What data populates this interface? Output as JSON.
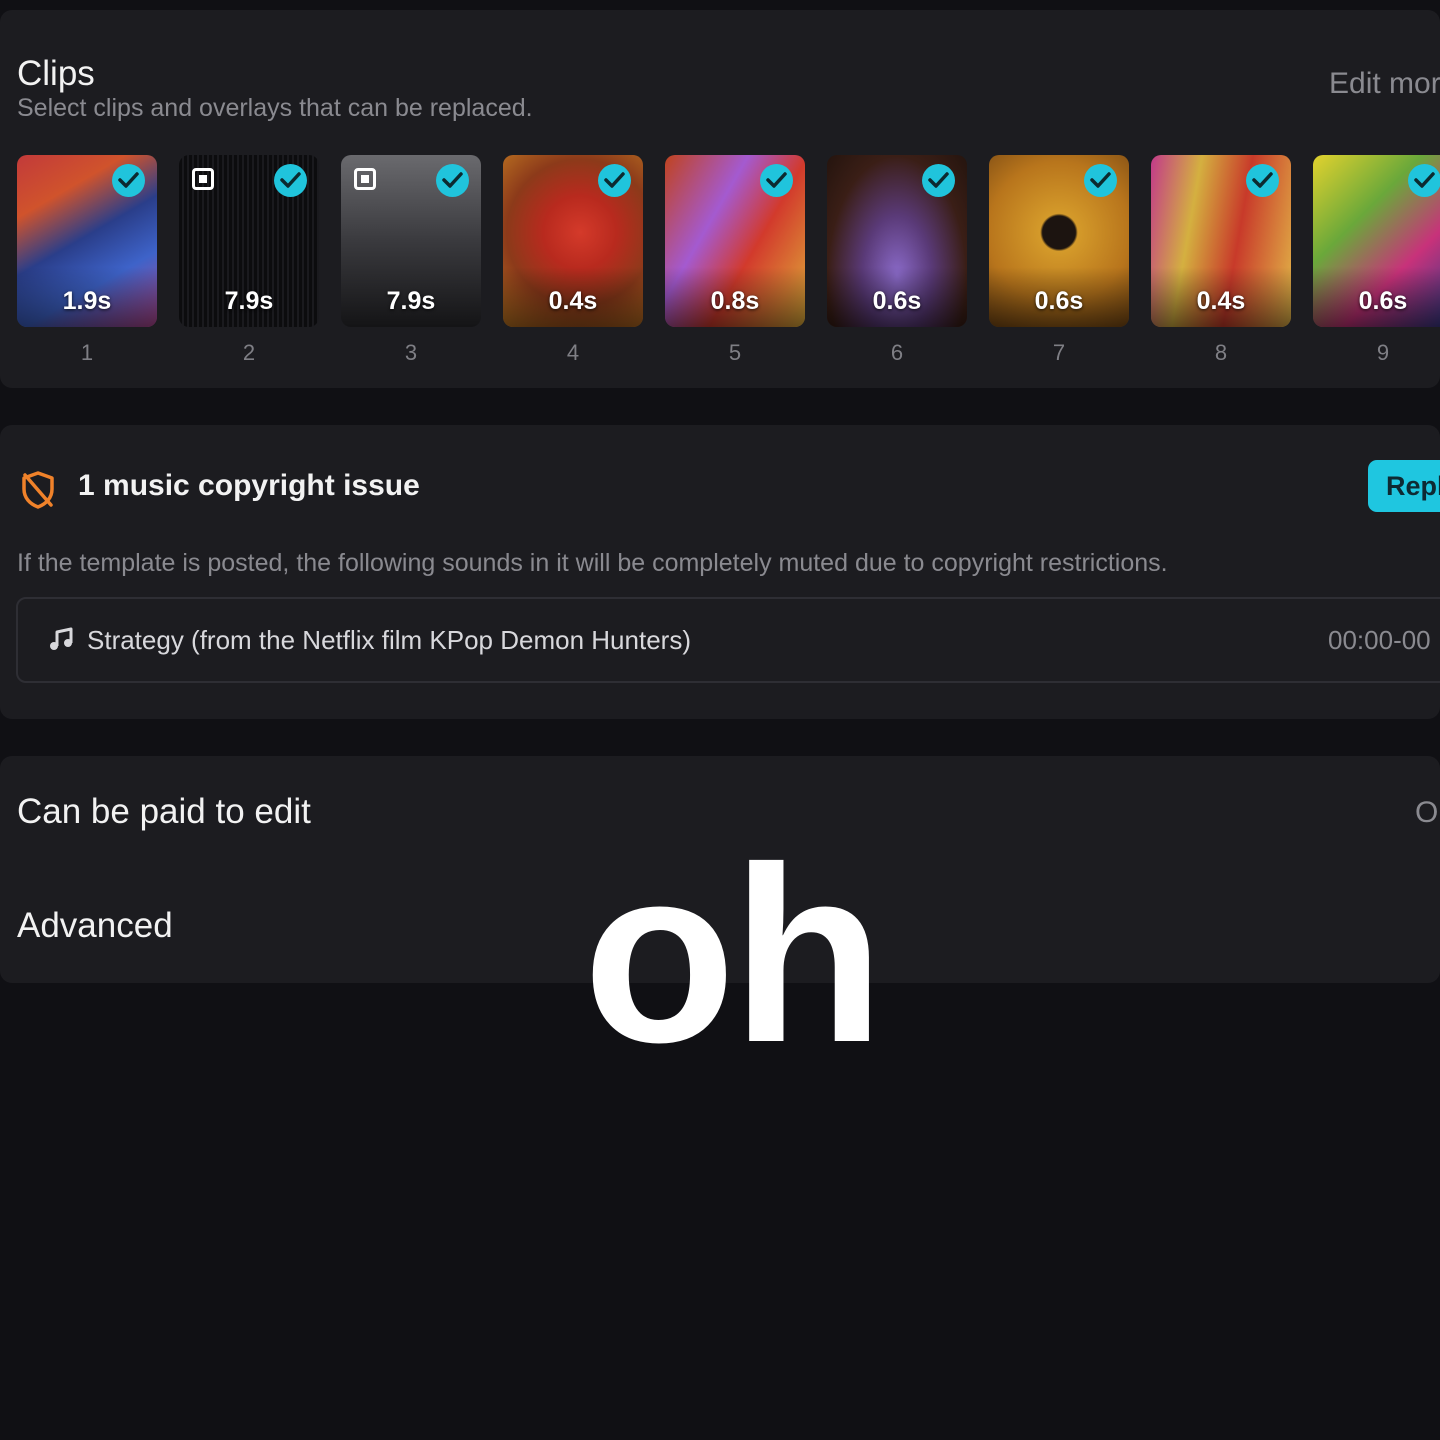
{
  "clips_panel": {
    "title": "Clips",
    "subtitle": "Select clips and overlays that can be replaced.",
    "edit_more": "Edit mor",
    "accent_color": "#20c4dc",
    "clips": [
      {
        "index": "1",
        "duration": "1.9s",
        "selected": true
      },
      {
        "index": "2",
        "duration": "7.9s",
        "selected": true,
        "icon": "overlay-square-icon"
      },
      {
        "index": "3",
        "duration": "7.9s",
        "selected": true,
        "icon": "overlay-square-icon"
      },
      {
        "index": "4",
        "duration": "0.4s",
        "selected": true
      },
      {
        "index": "5",
        "duration": "0.8s",
        "selected": true
      },
      {
        "index": "6",
        "duration": "0.6s",
        "selected": true
      },
      {
        "index": "7",
        "duration": "0.6s",
        "selected": true
      },
      {
        "index": "8",
        "duration": "0.4s",
        "selected": true
      },
      {
        "index": "9",
        "duration": "0.6s",
        "selected": true
      }
    ]
  },
  "copyright_panel": {
    "icon": "shield-slash-icon",
    "title": "1 music copyright issue",
    "replace_label": "Repl",
    "description": "If the template is posted, the following sounds in it will be completely muted due to copyright restrictions.",
    "sound": {
      "icon": "music-note-icon",
      "title": "Strategy (from the Netflix film KPop Demon Hunters)",
      "time": "00:00-00"
    }
  },
  "settings_panel": {
    "paid_label": "Can be paid to edit",
    "paid_value": "O",
    "advanced_label": "Advanced"
  },
  "overlay_caption": "oh"
}
